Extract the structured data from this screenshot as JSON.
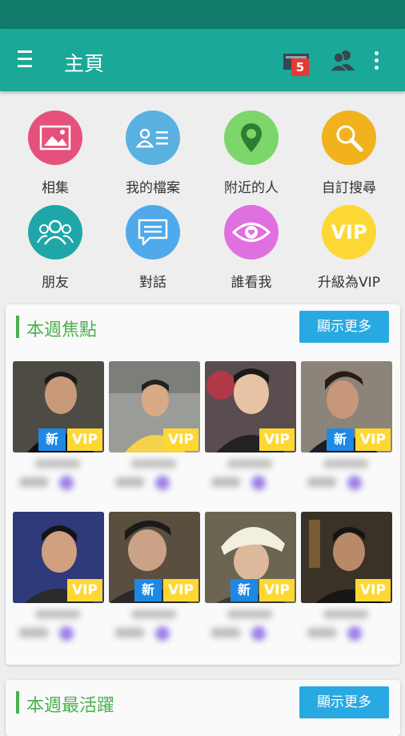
{
  "app": {
    "title": "主頁",
    "message_badge": "5"
  },
  "icons": {
    "menu": "hamburger-menu-icon",
    "messages": "messages-icon",
    "friends": "people-icon",
    "more": "more-vert-icon"
  },
  "grid": [
    {
      "label": "相集",
      "icon": "gallery-icon",
      "color": "#e5517a"
    },
    {
      "label": "我的檔案",
      "icon": "profile-card-icon",
      "color": "#5ab0e0"
    },
    {
      "label": "附近的人",
      "icon": "location-pin-icon",
      "color": "#7cd66a"
    },
    {
      "label": "自訂搜尋",
      "icon": "magnifier-icon",
      "color": "#f2b21e"
    },
    {
      "label": "朋友",
      "icon": "friends-icon",
      "color": "#1fa6a8"
    },
    {
      "label": "對話",
      "icon": "chat-icon",
      "color": "#4fa9ea"
    },
    {
      "label": "誰看我",
      "icon": "eye-icon",
      "color": "#e070e0"
    },
    {
      "label": "升級為VIP",
      "icon": "vip-badge-icon",
      "color": "#fdd835",
      "icon_text": "VIP"
    }
  ],
  "sections": [
    {
      "title": "本週焦點",
      "more_label": "顯示更多"
    },
    {
      "title": "本週最活躍",
      "more_label": "顯示更多"
    }
  ],
  "tags": {
    "vip": "VIP",
    "new": "新"
  },
  "users": [
    {
      "new": true,
      "vip": true,
      "bg": "#5a5a52"
    },
    {
      "new": false,
      "vip": true,
      "bg": "#8a8a86"
    },
    {
      "new": false,
      "vip": true,
      "bg": "#3a3a3a"
    },
    {
      "new": true,
      "vip": true,
      "bg": "#7a6a5a"
    },
    {
      "new": false,
      "vip": true,
      "bg": "#3a3a6a"
    },
    {
      "new": true,
      "vip": true,
      "bg": "#4a4a3a"
    },
    {
      "new": true,
      "vip": true,
      "bg": "#6a6a5a"
    },
    {
      "new": false,
      "vip": true,
      "bg": "#2a2a24"
    }
  ]
}
